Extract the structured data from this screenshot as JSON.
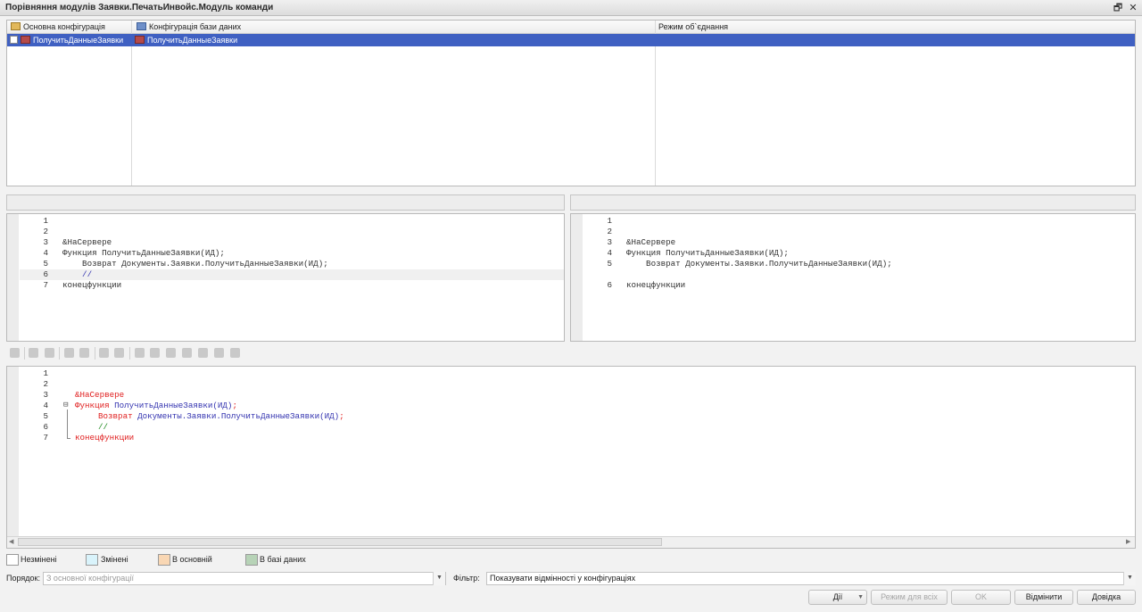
{
  "window": {
    "title": "Порівняння модулів Заявки.ПечатьИнвойс.Модуль команди",
    "restore_glyph": "🗗",
    "close_glyph": "✕"
  },
  "compare_table": {
    "headers": [
      "Основна конфігурація",
      "Конфігурація бази даних",
      "Режим об`єднання"
    ],
    "row": {
      "main": "ПолучитьДанныеЗаявки",
      "db": "ПолучитьДанныеЗаявки",
      "mode": ""
    }
  },
  "left_pane": {
    "header": "",
    "lines": [
      {
        "n": "1",
        "text": ""
      },
      {
        "n": "2",
        "text": ""
      },
      {
        "n": "3",
        "text": "&НаСервере"
      },
      {
        "n": "4",
        "text": "Функция ПолучитьДанныеЗаявки(ИД);"
      },
      {
        "n": "5",
        "text": "    Возврат Документы.Заявки.ПолучитьДанныеЗаявки(ИД);"
      },
      {
        "n": "6",
        "text": "    //"
      },
      {
        "n": "7",
        "text": "конецфункции"
      }
    ]
  },
  "right_pane": {
    "header": "",
    "lines": [
      {
        "n": "1",
        "text": ""
      },
      {
        "n": "2",
        "text": ""
      },
      {
        "n": "3",
        "text": "&НаСервере"
      },
      {
        "n": "4",
        "text": "Функция ПолучитьДанныеЗаявки(ИД);"
      },
      {
        "n": "5",
        "text": "    Возврат Документы.Заявки.ПолучитьДанныеЗаявки(ИД);"
      },
      {
        "n": "",
        "text": ""
      },
      {
        "n": "6",
        "text": "конецфункции"
      }
    ]
  },
  "result_editor": {
    "line_numbers": [
      "1",
      "2",
      "3",
      "4",
      "5",
      "6",
      "7"
    ],
    "l3": "&НаСервере",
    "l4_kw": "Функция",
    "l4_id": " ПолучитьДанныеЗаявки(ИД)",
    "l4_end": ";",
    "l5_kw": "Возврат",
    "l5_id": " Документы.Заявки.ПолучитьДанныеЗаявки(ИД)",
    "l5_end": ";",
    "l6": "//",
    "l7": "конецфункции",
    "fold_glyph": "⊟"
  },
  "legend": [
    {
      "label": "Незмінені",
      "color": "#ffffff"
    },
    {
      "label": "Змінені",
      "color": "#d9f3fb"
    },
    {
      "label": "В основній",
      "color": "#f9d7b4"
    },
    {
      "label": "В базі даних",
      "color": "#b7d3b7"
    }
  ],
  "form": {
    "order_label": "Порядок:",
    "order_value": "З основної конфігурації",
    "filter_label": "Фільтр:",
    "filter_value": "Показувати відмінності у конфігураціях"
  },
  "buttons": {
    "actions": "Дії",
    "merge_mode": "Режим для всіх",
    "ok": "OK",
    "cancel": "Відмінити",
    "help": "Довідка"
  },
  "colors": {
    "selection": "#3f60c2",
    "keyword": "#e02020",
    "identifier": "#3434b0",
    "comment": "#1f8a1f"
  }
}
